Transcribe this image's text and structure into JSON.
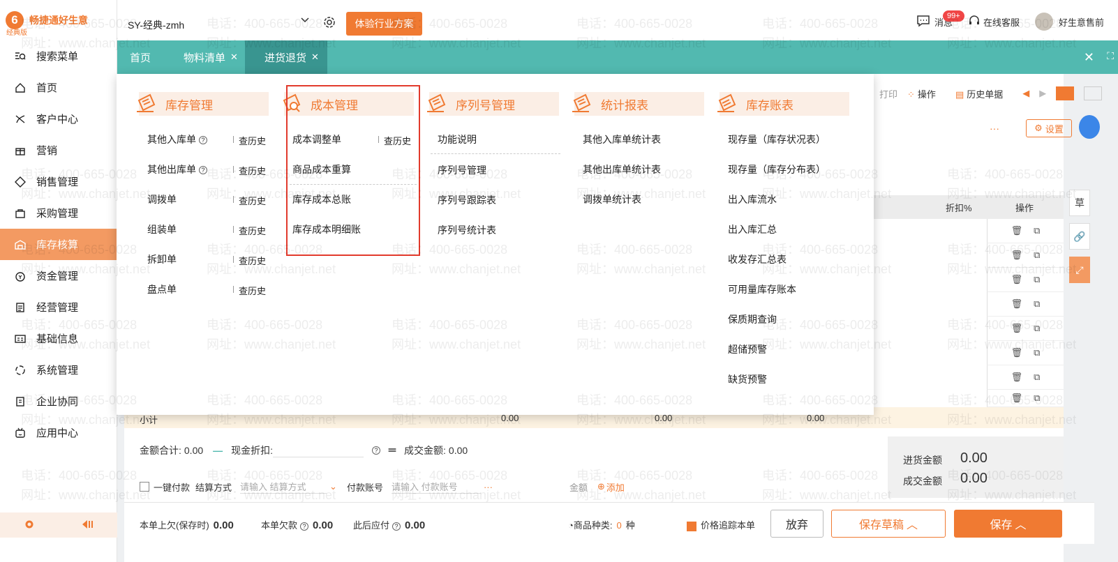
{
  "brand": {
    "logo_letter": "6",
    "name": "畅捷通好生意",
    "edition": "经典版"
  },
  "sidebar": {
    "items": [
      {
        "label": "搜索菜单",
        "icon": "search-menu-icon"
      },
      {
        "label": "首页",
        "icon": "home-icon"
      },
      {
        "label": "客户中心",
        "icon": "customer-icon"
      },
      {
        "label": "营销",
        "icon": "gift-icon"
      },
      {
        "label": "销售管理",
        "icon": "sales-icon"
      },
      {
        "label": "采购管理",
        "icon": "bag-icon"
      },
      {
        "label": "库存核算",
        "icon": "warehouse-icon",
        "active": true
      },
      {
        "label": "资金管理",
        "icon": "money-icon"
      },
      {
        "label": "经营管理",
        "icon": "report-icon"
      },
      {
        "label": "基础信息",
        "icon": "id-card-icon"
      },
      {
        "label": "系统管理",
        "icon": "system-icon"
      },
      {
        "label": "企业协同",
        "icon": "collab-icon"
      },
      {
        "label": "应用中心",
        "icon": "app-icon"
      }
    ]
  },
  "topbar": {
    "company": "SY-经典-zmh",
    "trial_button": "体验行业方案",
    "messages": "消息",
    "message_badge": "99+",
    "online_service": "在线客服",
    "user": "好生意售前"
  },
  "tabs": {
    "home": "首页",
    "bom": "物料清单",
    "purchase_return": "进货退货"
  },
  "toolbar": {
    "print": "打印",
    "operation": "操作",
    "history": "历史单据",
    "settings": "设置",
    "dots": "···"
  },
  "grid": {
    "discount_header": "折扣%",
    "op_header": "操作",
    "subtotal_label": "小计",
    "subtotal_values": [
      "0.00",
      "0.00",
      "0.00"
    ]
  },
  "summary": {
    "amount_total_label": "金额合计:",
    "amount_total": "0.00",
    "cash_discount_label": "现金折扣:",
    "deal_amount_label": "成交金额:",
    "deal_amount": "0.00"
  },
  "payment": {
    "one_click": "一键付款",
    "method_label": "结算方式",
    "method_placeholder": "请输入 结算方式",
    "account_label": "付款账号",
    "account_placeholder": "请输入 付款账号",
    "dots": "···",
    "amount_label": "金额",
    "add": "添加"
  },
  "totals": {
    "purchase_label": "进货金额",
    "purchase_value": "0.00",
    "deal_label": "成交金额",
    "deal_value": "0.00"
  },
  "footer": {
    "prev_owed_label": "本单上欠(保存时)",
    "prev_owed": "0.00",
    "owed_label": "本单欠款",
    "owed": "0.00",
    "after_pay_label": "此后应付",
    "after_pay": "0.00",
    "kinds_label": "商品种类:",
    "kinds_value": "0",
    "kinds_unit": "种",
    "trace_label": "价格追踪本单",
    "discard": "放弃",
    "save_draft": "保存草稿",
    "save": "保存"
  },
  "menu": {
    "columns": [
      {
        "title": "库存管理",
        "items": [
          {
            "label": "其他入库单",
            "help": true,
            "history": "查历史"
          },
          {
            "label": "其他出库单",
            "help": true,
            "history": "查历史"
          },
          {
            "label": "调拨单",
            "history": "查历史"
          },
          {
            "label": "组装单",
            "history": "查历史"
          },
          {
            "label": "拆卸单",
            "history": "查历史"
          },
          {
            "label": "盘点单",
            "history": "查历史"
          }
        ]
      },
      {
        "title": "成本管理",
        "items": [
          {
            "label": "成本调整单",
            "history": "查历史"
          },
          {
            "label": "商品成本重算"
          },
          {
            "label": "库存成本总账"
          },
          {
            "label": "库存成本明细账"
          }
        ]
      },
      {
        "title": "序列号管理",
        "items": [
          {
            "label": "功能说明"
          },
          {
            "label": "序列号管理"
          },
          {
            "label": "序列号跟踪表"
          },
          {
            "label": "序列号统计表"
          }
        ]
      },
      {
        "title": "统计报表",
        "items": [
          {
            "label": "其他入库单统计表"
          },
          {
            "label": "其他出库单统计表"
          },
          {
            "label": "调拨单统计表"
          }
        ]
      },
      {
        "title": "库存账表",
        "items": [
          {
            "label": "现存量（库存状况表）"
          },
          {
            "label": "现存量（库存分布表）"
          },
          {
            "label": "出入库流水"
          },
          {
            "label": "出入库汇总"
          },
          {
            "label": "收发存汇总表"
          },
          {
            "label": "可用量库存账本"
          },
          {
            "label": "保质期查询"
          },
          {
            "label": "超储预警"
          },
          {
            "label": "缺货预警"
          }
        ]
      }
    ]
  },
  "watermark": {
    "phone": "电话：400-665-0028",
    "site": "网址：www.chanjet.net"
  },
  "colors": {
    "accent": "#f07a32",
    "teal": "#52b9b0",
    "teal_active": "#399590",
    "highlight_border": "#e23a2c"
  }
}
